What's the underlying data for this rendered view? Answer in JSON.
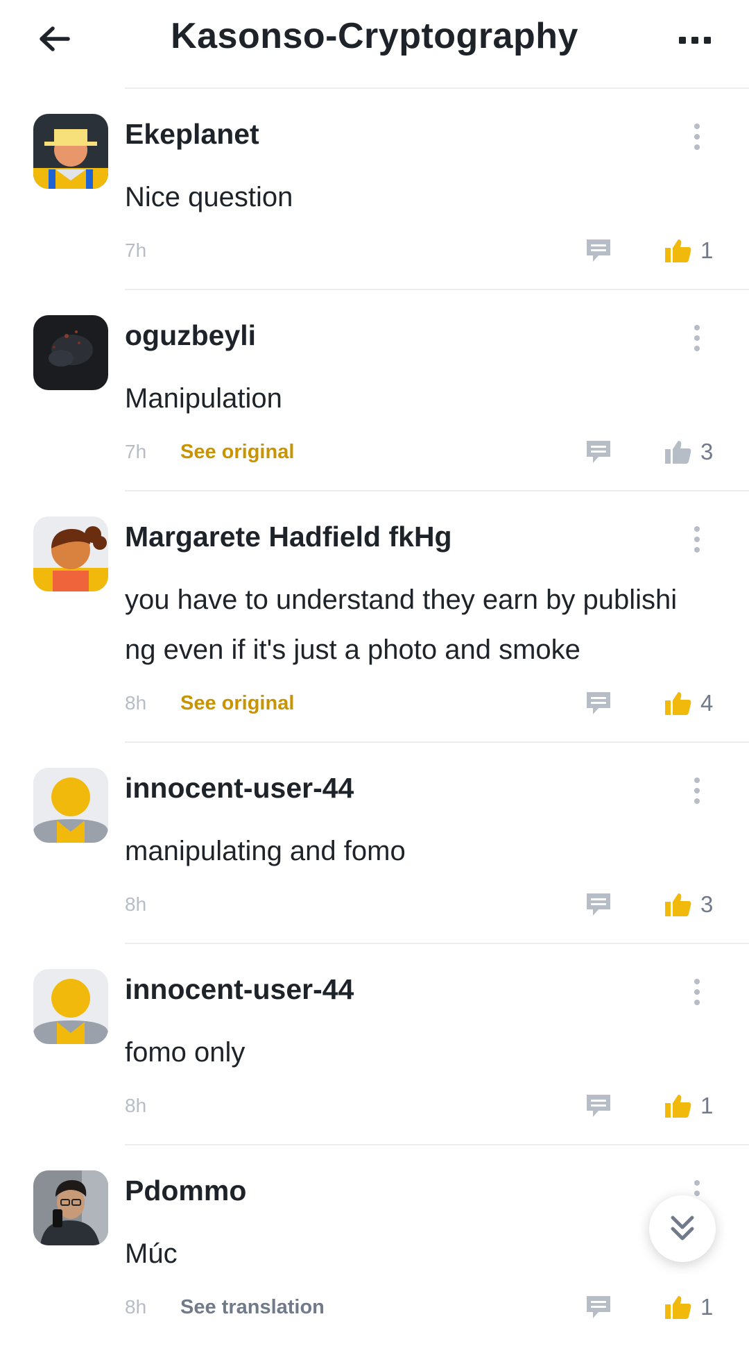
{
  "header": {
    "title": "Kasonso-Cryptography"
  },
  "colors": {
    "accent": "#f0b90b",
    "link": "#c99400",
    "muted": "#b7bdc6",
    "text": "#1e2329"
  },
  "comments": [
    {
      "name": "Ekeplanet",
      "avatar": "avatar-farmer-icon",
      "text": "Nice question",
      "time": "7h",
      "link": "",
      "likes": "1",
      "liked": true
    },
    {
      "name": "oguzbeyli",
      "avatar": "avatar-dark-photo",
      "text": "Manipulation",
      "time": "7h",
      "link": "See original",
      "likes": "3",
      "liked": false
    },
    {
      "name": "Margarete Hadfield fkHg",
      "avatar": "avatar-woman-icon",
      "text": "you have to understand they earn by publishi\nng even if it's just a photo and smoke",
      "time": "8h",
      "link": "See original",
      "likes": "4",
      "liked": true
    },
    {
      "name": "innocent-user-44",
      "avatar": "avatar-default-icon",
      "text": "manipulating and fomo",
      "time": "8h",
      "link": "",
      "likes": "3",
      "liked": true
    },
    {
      "name": "innocent-user-44",
      "avatar": "avatar-default-icon",
      "text": "fomo only",
      "time": "8h",
      "link": "",
      "likes": "1",
      "liked": true
    },
    {
      "name": "Pdommo",
      "avatar": "avatar-selfie-photo",
      "text": "Múc",
      "time": "8h",
      "link": "See translation",
      "likes": "1",
      "liked": true
    }
  ]
}
